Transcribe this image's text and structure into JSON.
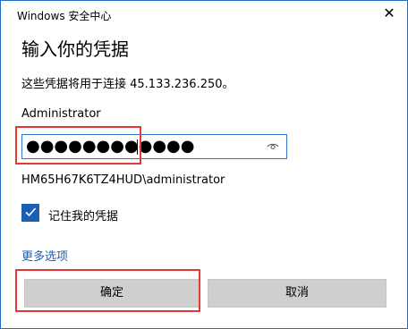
{
  "window": {
    "title": "Windows 安全中心",
    "close_glyph": "✕"
  },
  "dialog": {
    "heading": "输入你的凭据",
    "message": "这些凭据将用于连接 45.133.236.250。",
    "username": "Administrator",
    "password_mask": "●●●●●●●●●●●●",
    "account_text": "HM65H67K6TZ4HUD\\administrator",
    "remember_label": "记住我的凭据",
    "remember_checked": true,
    "more_options": "更多选项",
    "ok_label": "确定",
    "cancel_label": "取消"
  },
  "colors": {
    "accent": "#1a5fb4",
    "highlight": "#e53935",
    "button_bg": "#cfcfcf"
  }
}
